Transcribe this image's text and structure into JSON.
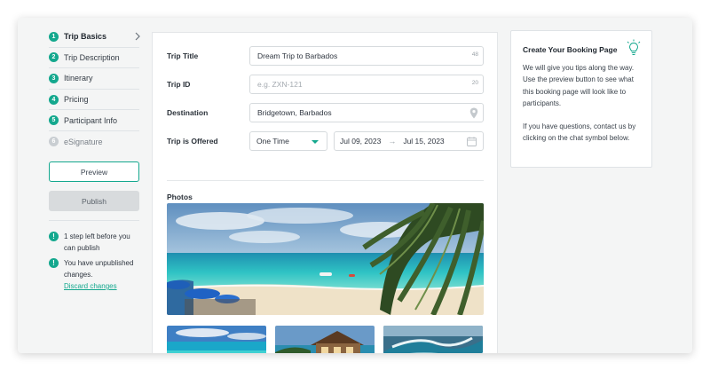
{
  "sidebar": {
    "steps": [
      {
        "num": "1",
        "label": "Trip Basics"
      },
      {
        "num": "2",
        "label": "Trip Description"
      },
      {
        "num": "3",
        "label": "Itinerary"
      },
      {
        "num": "4",
        "label": "Pricing"
      },
      {
        "num": "5",
        "label": "Participant Info"
      },
      {
        "num": "6",
        "label": "eSignature"
      }
    ],
    "preview_label": "Preview",
    "publish_label": "Publish",
    "notice1": "1 step left before you can publish",
    "notice2": "You have unpublished changes.",
    "discard_label": "Discard changes"
  },
  "form": {
    "trip_title": {
      "label": "Trip Title",
      "value": "Dream Trip to Barbados",
      "count": "48"
    },
    "trip_id": {
      "label": "Trip ID",
      "placeholder": "e.g. ZXN-121",
      "count": "20"
    },
    "destination": {
      "label": "Destination",
      "value": "Bridgetown, Barbados"
    },
    "offered": {
      "label": "Trip is Offered",
      "selected": "One Time",
      "start": "Jul 09, 2023",
      "arrow": "→",
      "end": "Jul 15, 2023"
    },
    "photos_label": "Photos"
  },
  "tips": {
    "title": "Create Your Booking Page",
    "para1": "We will give you tips along the way. Use the preview button to see what this booking page will look like to participants.",
    "para2": "If you have questions, contact us by clicking on the chat symbol below."
  },
  "colors": {
    "accent": "#14a88e",
    "inactive": "#c9ced2"
  },
  "icons": {
    "chevron": "chevron-right-icon",
    "pin": "location-pin-icon",
    "calendar": "calendar-icon",
    "bulb": "lightbulb-icon",
    "alert": "alert-icon"
  }
}
